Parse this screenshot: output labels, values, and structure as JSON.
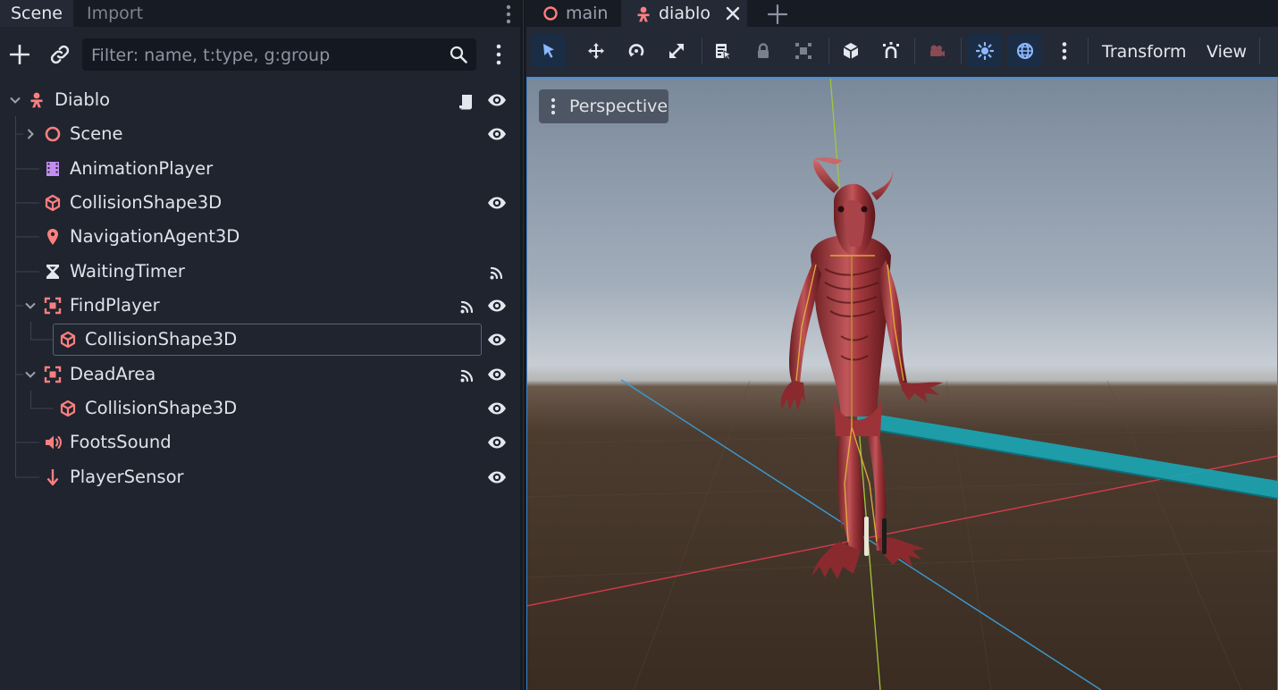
{
  "dock": {
    "tabs": [
      "Scene",
      "Import"
    ],
    "filter_placeholder": "Filter: name, t:type, g:group",
    "icons": [
      "add-node-icon",
      "instance-link-icon",
      "search-icon",
      "kebab-menu-icon"
    ]
  },
  "scene_tree": {
    "nodes": [
      {
        "label": "Diablo",
        "icon": "character-body-icon",
        "badges": [
          "script-icon",
          "eye-icon"
        ],
        "expanded": true
      },
      {
        "label": "Scene",
        "icon": "scene-circle-icon",
        "badges": [
          "eye-icon"
        ],
        "expanded": false
      },
      {
        "label": "AnimationPlayer",
        "icon": "film-icon",
        "badges": []
      },
      {
        "label": "CollisionShape3D",
        "icon": "cube-icon",
        "badges": [
          "eye-icon"
        ]
      },
      {
        "label": "NavigationAgent3D",
        "icon": "map-pin-icon",
        "badges": []
      },
      {
        "label": "WaitingTimer",
        "icon": "hourglass-icon",
        "badges": [
          "signal-icon"
        ]
      },
      {
        "label": "FindPlayer",
        "icon": "area-icon",
        "badges": [
          "signal-icon",
          "eye-icon"
        ],
        "expanded": true
      },
      {
        "label": "CollisionShape3D",
        "icon": "cube-icon",
        "badges": [
          "eye-icon"
        ],
        "selected": true
      },
      {
        "label": "DeadArea",
        "icon": "area-icon",
        "badges": [
          "signal-icon",
          "eye-icon"
        ],
        "expanded": true
      },
      {
        "label": "CollisionShape3D",
        "icon": "cube-icon",
        "badges": [
          "eye-icon"
        ]
      },
      {
        "label": "FootsSound",
        "icon": "speaker-icon",
        "badges": [
          "eye-icon"
        ]
      },
      {
        "label": "PlayerSensor",
        "icon": "ray-arrow-icon",
        "badges": [
          "eye-icon"
        ]
      }
    ]
  },
  "editor": {
    "scene_tabs": [
      {
        "label": "main",
        "icon": "scene-circle-icon"
      },
      {
        "label": "diablo",
        "icon": "character-body-icon",
        "active": true
      }
    ],
    "toolbar_menus": [
      "Transform",
      "View"
    ],
    "toolbar_tools": [
      "select-icon",
      "move-icon",
      "rotate-icon",
      "scale-icon",
      "list-select-icon",
      "lock-icon",
      "group-icon",
      "mesh-icon",
      "snap-icon",
      "camera-icon",
      "sun-preview-icon",
      "environment-preview-icon",
      "kebab-menu-icon"
    ],
    "viewport_label": "Perspective"
  },
  "colors": {
    "node_3d": "#fc7f7f",
    "animation": "#c38ef1",
    "selected_tool": "#8eb9ff",
    "axis_x": "#d43a4a",
    "axis_y": "#a4c63a",
    "axis_z": "#3a9ad4",
    "shape_cyan": "#1aa5b3"
  }
}
